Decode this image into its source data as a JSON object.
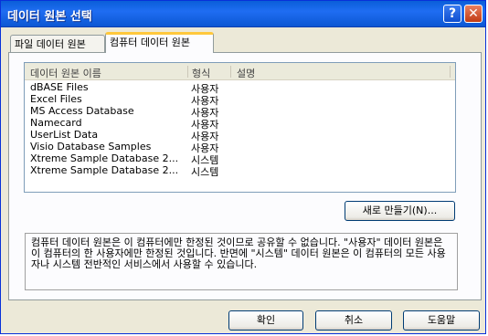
{
  "window": {
    "title": "데이터 원본 선택",
    "help_symbol": "?",
    "close_symbol": "✕"
  },
  "tabs": [
    {
      "label": "파일 데이터 원본"
    },
    {
      "label": "컴퓨터 데이터 원본"
    }
  ],
  "list": {
    "columns": [
      "데이터 원본 이름",
      "형식",
      "설명"
    ],
    "rows": [
      {
        "name": "dBASE Files",
        "type": "사용자"
      },
      {
        "name": "Excel Files",
        "type": "사용자"
      },
      {
        "name": "MS Access Database",
        "type": "사용자"
      },
      {
        "name": "Namecard",
        "type": "사용자"
      },
      {
        "name": "UserList Data",
        "type": "사용자"
      },
      {
        "name": "Visio Database Samples",
        "type": "사용자"
      },
      {
        "name": "Xtreme Sample Database 2...",
        "type": "시스템"
      },
      {
        "name": "Xtreme Sample Database 2...",
        "type": "시스템"
      }
    ]
  },
  "new_button_label": "새로 만들기(N)...",
  "description": "컴퓨터 데이터 원본은 이 컴퓨터에만 한정된 것이므로 공유할 수 없습니다. \"사용자\" 데이터 원본은 이 컴퓨터의 한 사용자에만 한정된 것입니다. 반면에 \"시스템\" 데이터 원본은 이 컴퓨터의 모든 사용자나 시스템 전반적인 서비스에서 사용할 수 있습니다.",
  "buttons": {
    "ok": "확인",
    "cancel": "취소",
    "help": "도움말"
  }
}
